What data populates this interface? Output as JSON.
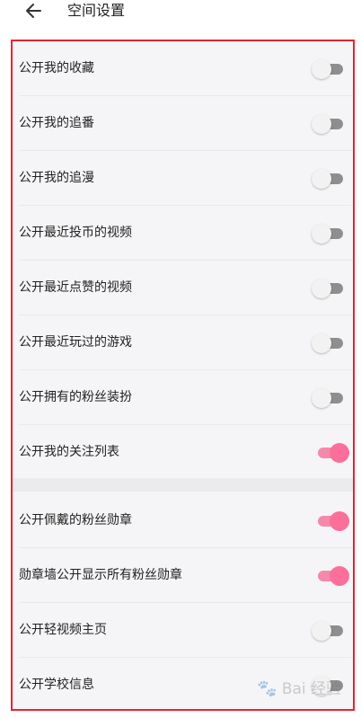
{
  "header": {
    "title": "空间设置",
    "back_icon": "arrow-left-icon"
  },
  "colors": {
    "accent": "#fb6f9a",
    "accent_track": "#f589ab",
    "frame": "#e8232f",
    "off_track": "#8e8e8e"
  },
  "settings": [
    {
      "label": "公开我的收藏",
      "enabled": false
    },
    {
      "label": "公开我的追番",
      "enabled": false
    },
    {
      "label": "公开我的追漫",
      "enabled": false
    },
    {
      "label": "公开最近投币的视频",
      "enabled": false
    },
    {
      "label": "公开最近点赞的视频",
      "enabled": false
    },
    {
      "label": "公开最近玩过的游戏",
      "enabled": false
    },
    {
      "label": "公开拥有的粉丝装扮",
      "enabled": false
    },
    {
      "label": "公开我的关注列表",
      "enabled": true
    },
    {
      "label": "公开佩戴的粉丝勋章",
      "enabled": true
    },
    {
      "label": "勋章墙公开显示所有粉丝勋章",
      "enabled": true
    },
    {
      "label": "公开轻视频主页",
      "enabled": false
    },
    {
      "label": "公开学校信息",
      "enabled": false
    }
  ],
  "watermark": {
    "text": "Bai 经验",
    "icon": "paw-icon"
  }
}
